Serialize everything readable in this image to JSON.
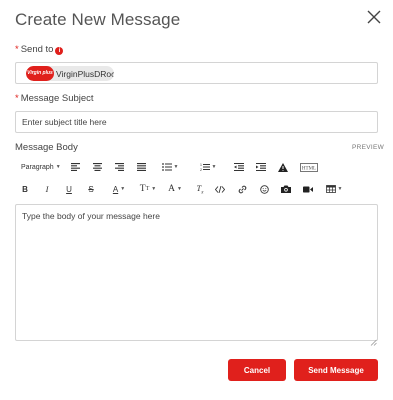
{
  "dialog": {
    "title": "Create New Message"
  },
  "send_to": {
    "label": "Send to",
    "required_mark": "*",
    "info_icon": "info-icon",
    "recipient": {
      "logo_text": "Virgin plus",
      "name": "VirginPlusDRock"
    }
  },
  "subject": {
    "label": "Message Subject",
    "required_mark": "*",
    "placeholder": "Enter subject title here",
    "value": ""
  },
  "body": {
    "label": "Message Body",
    "preview_label": "PREVIEW",
    "placeholder": "Type the body of your message here",
    "value": ""
  },
  "toolbar": {
    "paragraph_label": "Paragraph",
    "html_label": "HTML",
    "row1_icons": [
      "paragraph-format-select",
      "align-left-icon",
      "align-center-icon",
      "align-right-icon",
      "align-justify-icon",
      "unordered-list-icon",
      "ordered-list-icon",
      "outdent-icon",
      "indent-icon",
      "warning-icon",
      "html-icon"
    ],
    "row2_icons": [
      "bold-icon",
      "italic-icon",
      "underline-icon",
      "strikethrough-icon",
      "text-color-icon",
      "font-size-icon",
      "font-family-icon",
      "clear-format-icon",
      "code-icon",
      "link-icon",
      "emoji-icon",
      "camera-icon",
      "video-icon",
      "table-icon"
    ]
  },
  "actions": {
    "cancel_label": "Cancel",
    "send_label": "Send Message"
  },
  "colors": {
    "accent": "#e0201c",
    "border": "#d4d4d4",
    "text": "#333333"
  }
}
